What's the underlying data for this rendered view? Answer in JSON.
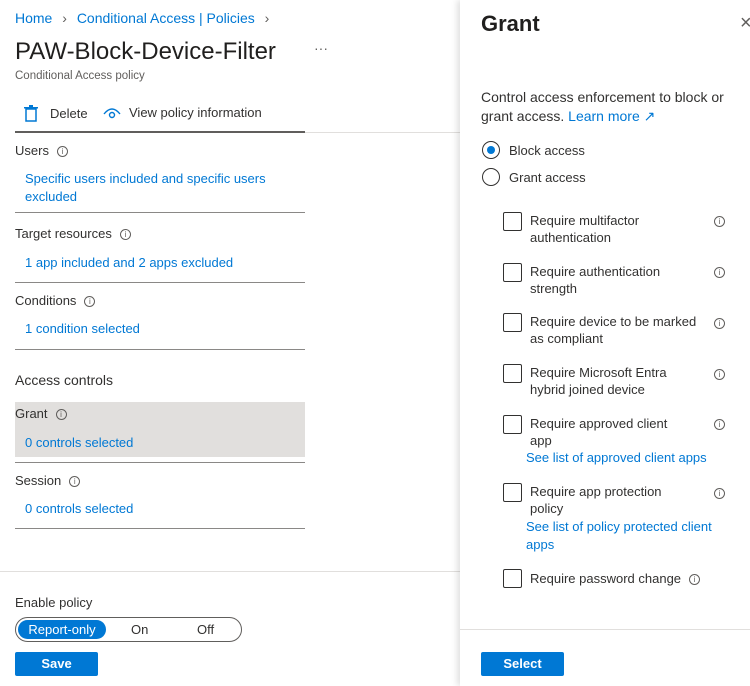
{
  "breadcrumb": {
    "home": "Home",
    "policies": "Conditional Access | Policies"
  },
  "title": "PAW-Block-Device-Filter",
  "more": "···",
  "subtitle": "Conditional Access policy",
  "toolbar": {
    "delete": "Delete",
    "view_info": "View policy information"
  },
  "sections": {
    "users": {
      "label": "Users",
      "value": "Specific users included and specific users excluded"
    },
    "target": {
      "label": "Target resources",
      "value": "1 app included and 2 apps excluded"
    },
    "conditions": {
      "label": "Conditions",
      "value": "1 condition selected"
    },
    "access_controls": "Access controls",
    "grant": {
      "label": "Grant",
      "value": "0 controls selected"
    },
    "session": {
      "label": "Session",
      "value": "0 controls selected"
    }
  },
  "enable_policy": {
    "label": "Enable policy",
    "options": [
      "Report-only",
      "On",
      "Off"
    ],
    "selected": "Report-only"
  },
  "save": "Save",
  "panel": {
    "title": "Grant",
    "close": "×",
    "desc1": "Control access enforcement to block or",
    "desc2": "grant access.",
    "learn_more": "Learn more",
    "radios": {
      "block": "Block access",
      "grant": "Grant access",
      "selected": "block"
    },
    "options": [
      {
        "l1": "Require multifactor",
        "l2": "authentication"
      },
      {
        "l1": "Require authentication",
        "l2": "strength"
      },
      {
        "l1": "Require device to be marked",
        "l2": "as compliant"
      },
      {
        "l1": "Require Microsoft Entra",
        "l2": "hybrid joined device"
      },
      {
        "l1": "Require approved client",
        "l2": "app",
        "link": "See list of approved client apps"
      },
      {
        "l1": "Require app protection",
        "l2": "policy",
        "link1": "See list of policy protected client",
        "link2": "apps"
      },
      {
        "l1": "Require password change"
      }
    ],
    "select": "Select"
  }
}
